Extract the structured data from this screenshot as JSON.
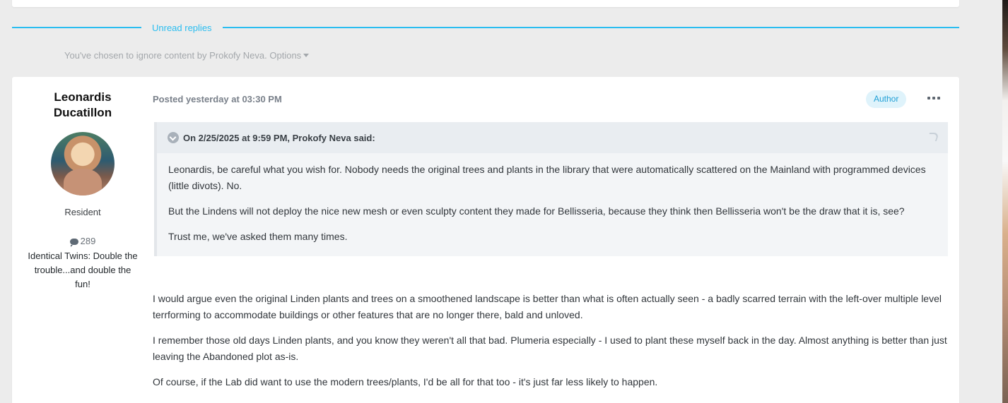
{
  "divider": {
    "label": "Unread replies"
  },
  "ignored_notice": {
    "text": "You've chosen to ignore content by Prokofy Neva.",
    "options_label": "Options"
  },
  "post": {
    "author": {
      "name": "Leonardis Ducatillon",
      "rank": "Resident",
      "post_count": "289",
      "signature": "Identical Twins: Double the trouble...and double the fun!"
    },
    "meta": {
      "posted": "Posted yesterday at 03:30 PM",
      "badge": "Author"
    },
    "quote": {
      "citation": "On 2/25/2025 at 9:59 PM, Prokofy Neva said:",
      "paragraphs": [
        "Leonardis, be careful what you wish for. Nobody needs the original trees and plants in the library that were automatically scattered on the Mainland with programmed devices (little divots). No.",
        "But the Lindens will not deploy the nice new mesh or even sculpty content they made for Bellisseria, because they think then Bellisseria won't be the draw that it is, see?",
        "Trust me, we've asked them many times."
      ]
    },
    "body": [
      "I would argue even the original Linden plants and trees on a smoothened landscape is better than what is often actually seen - a badly scarred terrain with the left-over multiple level terrforming to accommodate buildings or other features that are no longer there, bald and unloved.",
      "I remember those old days Linden plants, and you know they weren't all that bad. Plumeria especially - I used to plant these myself back in the day. Almost anything is better than just leaving the Abandoned plot as-is.",
      "Of course, if the Lab did want to use the modern trees/plants, I'd be all for that too - it's just far less likely to happen."
    ]
  },
  "colors": {
    "accent": "#29bdf0",
    "badge_background": "#dff3fb",
    "background": "#ececec"
  },
  "icons": [
    "chevron-down-icon",
    "comment-icon",
    "more-options-icon",
    "share-icon"
  ]
}
